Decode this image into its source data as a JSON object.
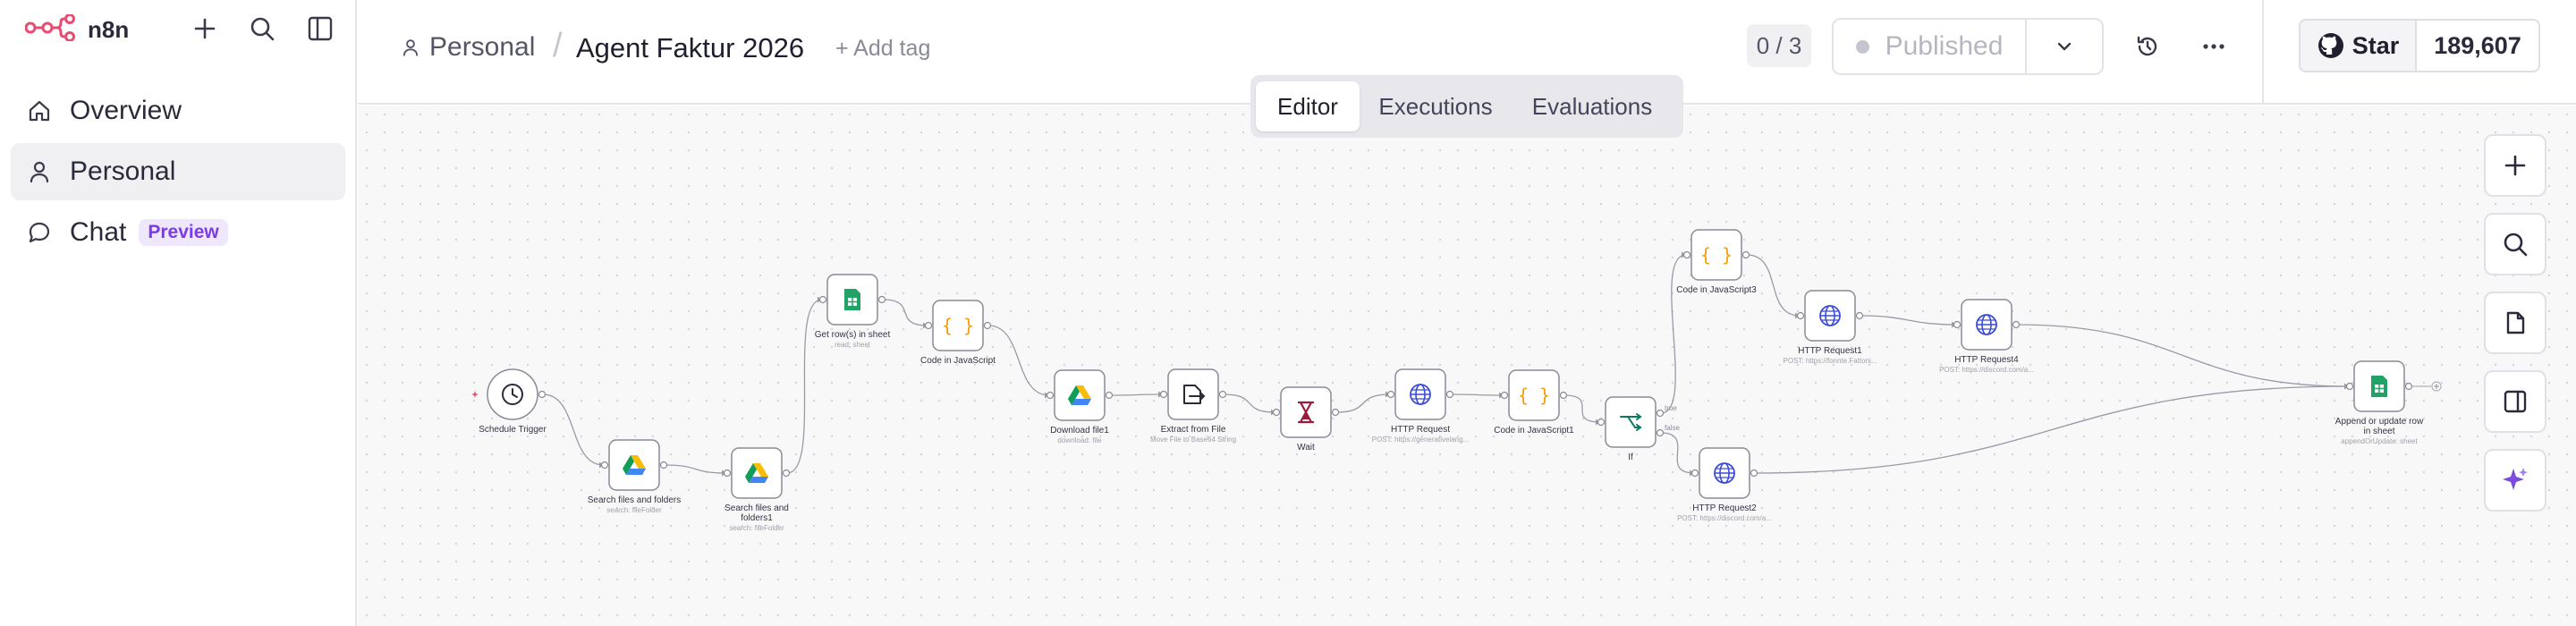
{
  "brand": {
    "name": "n8n",
    "color": "#ea4b71"
  },
  "sidebar": {
    "items": [
      {
        "label": "Overview",
        "icon": "home-icon"
      },
      {
        "label": "Personal",
        "icon": "user-icon"
      },
      {
        "label": "Chat",
        "icon": "chat-icon",
        "badge": "Preview"
      }
    ]
  },
  "header": {
    "project": "Personal",
    "workflow_title": "Agent Faktur 2026",
    "add_tag": "+ Add tag",
    "counter": "0 / 3",
    "publish_label": "Published"
  },
  "github": {
    "star_label": "Star",
    "count": "189,607"
  },
  "tabs": [
    {
      "label": "Editor",
      "active": true
    },
    {
      "label": "Executions",
      "active": false
    },
    {
      "label": "Evaluations",
      "active": false
    }
  ],
  "right_tools": [
    "plus-icon",
    "search-icon",
    "sticky-note-icon",
    "panel-icon",
    "sparkle-icon"
  ],
  "workflow": {
    "nodes": [
      {
        "id": "n1",
        "name": "Schedule Trigger",
        "sub": "",
        "icon": "clock"
      },
      {
        "id": "n2",
        "name": "Search files and folders",
        "sub": "search: fileFolder",
        "icon": "gdrive"
      },
      {
        "id": "n3",
        "name": "Search files and folders1",
        "sub": "search: fileFolder",
        "icon": "gdrive"
      },
      {
        "id": "n4",
        "name": "Get row(s) in sheet",
        "sub": "read: sheet",
        "icon": "sheets"
      },
      {
        "id": "n5",
        "name": "Code in JavaScript",
        "sub": "",
        "icon": "code"
      },
      {
        "id": "n6",
        "name": "Download file1",
        "sub": "download: file",
        "icon": "gdrive"
      },
      {
        "id": "n7",
        "name": "Extract from File",
        "sub": "Move File to Base64 String",
        "icon": "extract"
      },
      {
        "id": "n8",
        "name": "Wait",
        "sub": "",
        "icon": "wait"
      },
      {
        "id": "n9",
        "name": "HTTP Request",
        "sub": "POST: https://generativelang...",
        "icon": "globe"
      },
      {
        "id": "n10",
        "name": "Code in JavaScript1",
        "sub": "",
        "icon": "code"
      },
      {
        "id": "n11",
        "name": "If",
        "sub": "",
        "icon": "if",
        "ports": [
          "true",
          "false"
        ]
      },
      {
        "id": "n12",
        "name": "Code in JavaScript3",
        "sub": "",
        "icon": "code"
      },
      {
        "id": "n13",
        "name": "HTTP Request1",
        "sub": "POST: https://fonnte.Fattoni...",
        "icon": "globe"
      },
      {
        "id": "n14",
        "name": "HTTP Request4",
        "sub": "POST: https://discord.com/a...",
        "icon": "globe"
      },
      {
        "id": "n15",
        "name": "HTTP Request2",
        "sub": "POST: https://discord.com/a...",
        "icon": "globe"
      },
      {
        "id": "n16",
        "name": "Append or update row in sheet",
        "sub": "appendOrUpdate: sheet",
        "icon": "sheets"
      }
    ],
    "connections": [
      [
        "n1",
        "n2"
      ],
      [
        "n2",
        "n3"
      ],
      [
        "n3",
        "n4"
      ],
      [
        "n4",
        "n5"
      ],
      [
        "n5",
        "n6"
      ],
      [
        "n6",
        "n7"
      ],
      [
        "n7",
        "n8"
      ],
      [
        "n8",
        "n9"
      ],
      [
        "n9",
        "n10"
      ],
      [
        "n10",
        "n11"
      ],
      [
        "n11",
        "n12"
      ],
      [
        "n11",
        "n15"
      ],
      [
        "n12",
        "n13"
      ],
      [
        "n13",
        "n14"
      ],
      [
        "n14",
        "n16"
      ],
      [
        "n15",
        "n16"
      ]
    ]
  }
}
